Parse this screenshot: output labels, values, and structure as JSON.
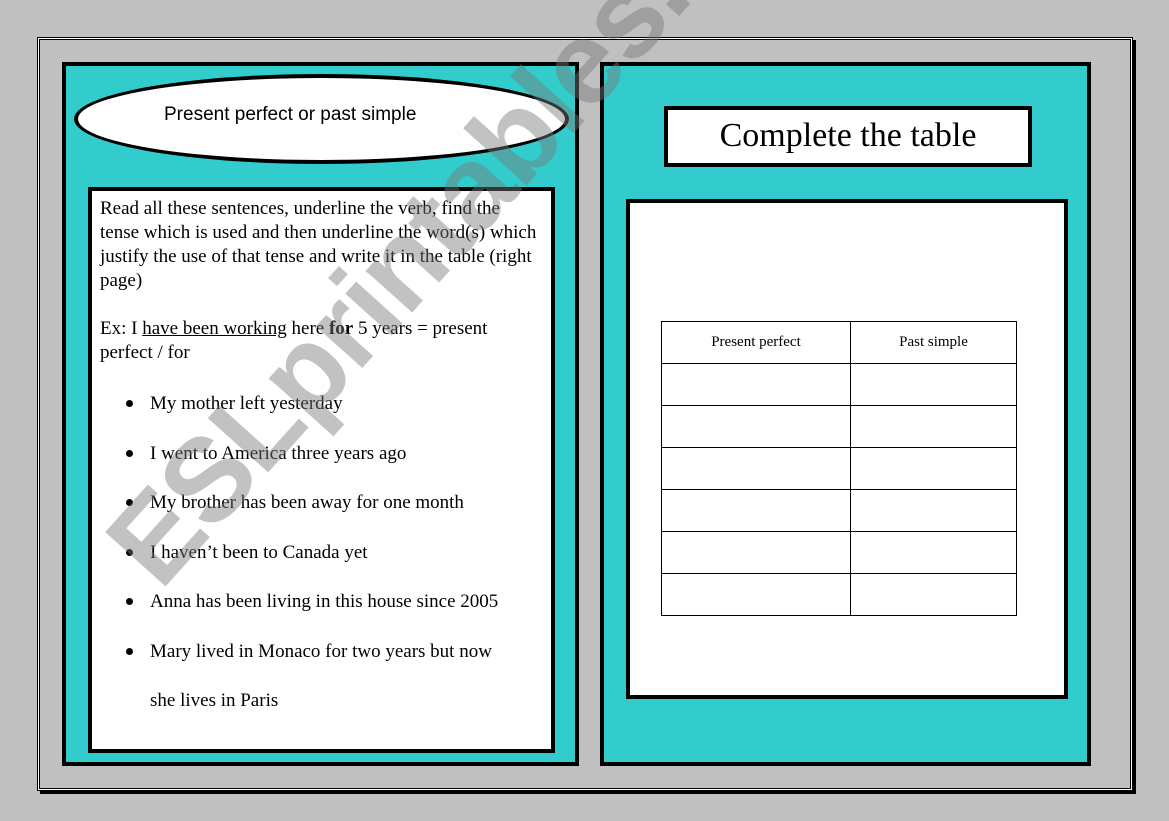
{
  "left_page": {
    "title": "Present perfect or past simple",
    "instructions": "Read all these sentences, underline the verb, find the tense which is used and then underline the word(s) which justify the use of that tense and write it in the table (right page)",
    "example": {
      "prefix": "Ex: I ",
      "underlined": "have been working",
      "middle": " here ",
      "bold": "for",
      "suffix": " 5 years = present perfect / for"
    },
    "sentences": [
      "My mother left yesterday",
      "I went to America three years ago",
      "My brother has been away for one month",
      "I haven’t been to Canada yet",
      "Anna has been living in this house since 2005",
      "Mary lived in Monaco for two years but now"
    ],
    "sentence_continuation": "she lives in Paris"
  },
  "right_page": {
    "title": "Complete the table",
    "table": {
      "headers": [
        "Present perfect",
        "Past simple"
      ],
      "rows": [
        [
          "",
          ""
        ],
        [
          "",
          ""
        ],
        [
          "",
          ""
        ],
        [
          "",
          ""
        ],
        [
          "",
          ""
        ],
        [
          "",
          ""
        ]
      ]
    }
  },
  "watermark": "ESLprintables.com",
  "colors": {
    "panel": "#33cccc",
    "background": "#c0c0c0"
  }
}
